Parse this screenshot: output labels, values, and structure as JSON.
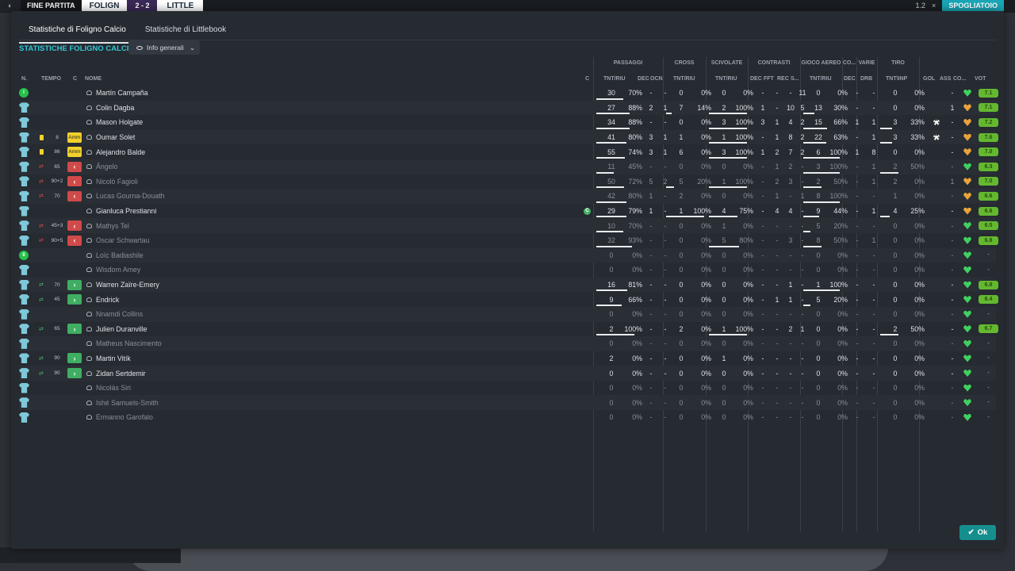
{
  "topbar": {
    "label": "FINE PARTITA",
    "home": "FOLIGN",
    "score": "2 - 2",
    "away": "LITTLE",
    "zoom": "1.2",
    "close": "×",
    "cta": "SPOGLIATOIO"
  },
  "tabs": [
    {
      "label": "Statistiche di Foligno Calcio"
    },
    {
      "label": "Statistiche di Littlebook"
    }
  ],
  "section_title": "STATISTICHE FOLIGNO CALCIO",
  "dropdown_label": "Info generali",
  "groups": {
    "passaggi": "PASSAGGI",
    "cross": "CROSS",
    "scivolate": "SCIVOLATE",
    "contrasti": "CONTRASTI",
    "gioco_aereo": "GIOCO AEREO",
    "co": "CO...",
    "varie": "VARIE",
    "tiro": "TIRO"
  },
  "columns": {
    "n": "N.",
    "tempo": "TEMPO",
    "c": "C",
    "nome": "NOME",
    "cap": "C",
    "pass_tnt": "TNT/RIU",
    "dec": "DEC",
    "ocn": "OCN",
    "cross_tnt": "TNT/RIU",
    "sciv_tnt": "TNT/RIU",
    "c_dec": "DEC",
    "fft": "FFT",
    "rec": "REC",
    "s": "S...",
    "aer_tnt": "TNT/RIU",
    "co_dec": "DEC",
    "drb": "DRB",
    "tiro_tnt": "TNT\\INP",
    "gol": "GOL",
    "ass": "ASS",
    "co": "CO...",
    "vot": "VOT"
  },
  "players": [
    {
      "pos": "I",
      "min": "",
      "card": "",
      "name": "Martín Campaña",
      "cap": "",
      "p": "30",
      "pp": "70%",
      "dec": "-",
      "ocn": "-",
      "cr": "0",
      "crp": "0%",
      "sc": "0",
      "scp": "0%",
      "cdec": "-",
      "fft": "-",
      "rec": "-",
      "s": "11",
      "ae": "0",
      "aep": "0%",
      "codec": "-",
      "drb": "-",
      "t": "0",
      "tp": "0%",
      "gol": "",
      "ass": "-",
      "heart": "g",
      "vote": "7.1",
      "dim": false
    },
    {
      "pos": "",
      "min": "",
      "card": "",
      "name": "Colin Dagba",
      "cap": "",
      "p": "27",
      "pp": "88%",
      "dec": "2",
      "ocn": "1",
      "cr": "7",
      "crp": "14%",
      "sc": "2",
      "scp": "100%",
      "cdec": "1",
      "fft": "-",
      "rec": "10",
      "s": "5",
      "ae": "13",
      "aep": "30%",
      "codec": "-",
      "drb": "-",
      "t": "0",
      "tp": "0%",
      "gol": "",
      "ass": "1",
      "heart": "o",
      "vote": "7.1",
      "dim": false
    },
    {
      "pos": "",
      "min": "",
      "card": "",
      "name": "Mason Holgate",
      "cap": "",
      "p": "34",
      "pp": "88%",
      "dec": "-",
      "ocn": "-",
      "cr": "0",
      "crp": "0%",
      "sc": "3",
      "scp": "100%",
      "cdec": "3",
      "fft": "1",
      "rec": "4",
      "s": "2",
      "ae": "15",
      "aep": "66%",
      "codec": "1",
      "drb": "1",
      "t": "3",
      "tp": "33%",
      "gol": "ball",
      "ass": "-",
      "heart": "o",
      "vote": "7.2",
      "dim": false
    },
    {
      "pos": "",
      "min": "8",
      "card": "Amm",
      "name": "Oumar Solet",
      "cap": "",
      "p": "41",
      "pp": "80%",
      "dec": "3",
      "ocn": "1",
      "cr": "1",
      "crp": "0%",
      "sc": "1",
      "scp": "100%",
      "cdec": "-",
      "fft": "1",
      "rec": "8",
      "s": "2",
      "ae": "22",
      "aep": "63%",
      "codec": "-",
      "drb": "1",
      "t": "3",
      "tp": "33%",
      "gol": "ball",
      "ass": "-",
      "heart": "o",
      "vote": "7.6",
      "dim": false
    },
    {
      "pos": "",
      "min": "86",
      "card": "Amm",
      "name": "Alejandro Balde",
      "cap": "",
      "p": "55",
      "pp": "74%",
      "dec": "3",
      "ocn": "1",
      "cr": "6",
      "crp": "0%",
      "sc": "3",
      "scp": "100%",
      "cdec": "1",
      "fft": "2",
      "rec": "7",
      "s": "2",
      "ae": "6",
      "aep": "100%",
      "codec": "1",
      "drb": "8",
      "t": "0",
      "tp": "0%",
      "gol": "",
      "ass": "-",
      "heart": "o",
      "vote": "7.0",
      "dim": false
    },
    {
      "pos": "",
      "min": "65",
      "card": "out",
      "name": "Ângelo",
      "cap": "",
      "p": "11",
      "pp": "45%",
      "dec": "-",
      "ocn": "-",
      "cr": "0",
      "crp": "0%",
      "sc": "0",
      "scp": "0%",
      "cdec": "-",
      "fft": "1",
      "rec": "2",
      "s": "-",
      "ae": "3",
      "aep": "100%",
      "codec": "-",
      "drb": "1",
      "t": "2",
      "tp": "50%",
      "gol": "",
      "ass": "-",
      "heart": "g",
      "vote": "6.3",
      "dim": true
    },
    {
      "pos": "",
      "min": "90+2",
      "card": "out",
      "name": "Nicolò Fagioli",
      "cap": "",
      "p": "50",
      "pp": "72%",
      "dec": "5",
      "ocn": "2",
      "cr": "5",
      "crp": "20%",
      "sc": "1",
      "scp": "100%",
      "cdec": "-",
      "fft": "2",
      "rec": "3",
      "s": "-",
      "ae": "2",
      "aep": "50%",
      "codec": "-",
      "drb": "1",
      "t": "2",
      "tp": "0%",
      "gol": "",
      "ass": "1",
      "heart": "o",
      "vote": "7.0",
      "dim": true
    },
    {
      "pos": "",
      "min": "70",
      "card": "out",
      "name": "Lucas Gourna-Douath",
      "cap": "",
      "p": "42",
      "pp": "80%",
      "dec": "1",
      "ocn": "-",
      "cr": "2",
      "crp": "0%",
      "sc": "0",
      "scp": "0%",
      "cdec": "-",
      "fft": "1",
      "rec": "-",
      "s": "1",
      "ae": "8",
      "aep": "100%",
      "codec": "-",
      "drb": "-",
      "t": "1",
      "tp": "0%",
      "gol": "",
      "ass": "-",
      "heart": "o",
      "vote": "6.6",
      "dim": true
    },
    {
      "pos": "",
      "min": "",
      "card": "",
      "name": "Gianluca Prestianni",
      "cap": "C",
      "p": "29",
      "pp": "79%",
      "dec": "1",
      "ocn": "-",
      "cr": "1",
      "crp": "100%",
      "sc": "4",
      "scp": "75%",
      "cdec": "-",
      "fft": "4",
      "rec": "4",
      "s": "-",
      "ae": "9",
      "aep": "44%",
      "codec": "-",
      "drb": "1",
      "t": "4",
      "tp": "25%",
      "gol": "",
      "ass": "-",
      "heart": "o",
      "vote": "6.6",
      "dim": false
    },
    {
      "pos": "",
      "min": "45+3",
      "card": "out",
      "name": "Mathys Tel",
      "cap": "",
      "p": "10",
      "pp": "70%",
      "dec": "-",
      "ocn": "-",
      "cr": "0",
      "crp": "0%",
      "sc": "1",
      "scp": "0%",
      "cdec": "-",
      "fft": "-",
      "rec": "-",
      "s": "-",
      "ae": "5",
      "aep": "20%",
      "codec": "-",
      "drb": "-",
      "t": "0",
      "tp": "0%",
      "gol": "",
      "ass": "-",
      "heart": "g",
      "vote": "6.5",
      "dim": true
    },
    {
      "pos": "",
      "min": "90+5",
      "card": "out",
      "name": "Oscar Schwartau",
      "cap": "",
      "p": "32",
      "pp": "93%",
      "dec": "-",
      "ocn": "-",
      "cr": "0",
      "crp": "0%",
      "sc": "5",
      "scp": "80%",
      "cdec": "-",
      "fft": "-",
      "rec": "3",
      "s": "-",
      "ae": "8",
      "aep": "50%",
      "codec": "-",
      "drb": "1",
      "t": "0",
      "tp": "0%",
      "gol": "",
      "ass": "-",
      "heart": "g",
      "vote": "6.8",
      "dim": true
    },
    {
      "pos": "II",
      "min": "",
      "card": "",
      "name": "Loïc Badiashile",
      "cap": "",
      "p": "0",
      "pp": "0%",
      "dec": "-",
      "ocn": "-",
      "cr": "0",
      "crp": "0%",
      "sc": "0",
      "scp": "0%",
      "cdec": "-",
      "fft": "-",
      "rec": "-",
      "s": "-",
      "ae": "0",
      "aep": "0%",
      "codec": "-",
      "drb": "-",
      "t": "0",
      "tp": "0%",
      "gol": "",
      "ass": "-",
      "heart": "g",
      "vote": "-",
      "dim": true
    },
    {
      "pos": "",
      "min": "",
      "card": "",
      "name": "Wisdom Amey",
      "cap": "",
      "p": "0",
      "pp": "0%",
      "dec": "-",
      "ocn": "-",
      "cr": "0",
      "crp": "0%",
      "sc": "0",
      "scp": "0%",
      "cdec": "-",
      "fft": "-",
      "rec": "-",
      "s": "-",
      "ae": "0",
      "aep": "0%",
      "codec": "-",
      "drb": "-",
      "t": "0",
      "tp": "0%",
      "gol": "",
      "ass": "-",
      "heart": "g",
      "vote": "-",
      "dim": true
    },
    {
      "pos": "",
      "min": "70",
      "card": "in",
      "name": "Warren Zaïre-Emery",
      "cap": "",
      "p": "16",
      "pp": "81%",
      "dec": "-",
      "ocn": "-",
      "cr": "0",
      "crp": "0%",
      "sc": "0",
      "scp": "0%",
      "cdec": "-",
      "fft": "-",
      "rec": "1",
      "s": "-",
      "ae": "1",
      "aep": "100%",
      "codec": "-",
      "drb": "-",
      "t": "0",
      "tp": "0%",
      "gol": "",
      "ass": "-",
      "heart": "g",
      "vote": "6.8",
      "dim": false
    },
    {
      "pos": "",
      "min": "45",
      "card": "in",
      "name": "Endrick",
      "cap": "",
      "p": "9",
      "pp": "66%",
      "dec": "-",
      "ocn": "-",
      "cr": "0",
      "crp": "0%",
      "sc": "0",
      "scp": "0%",
      "cdec": "-",
      "fft": "1",
      "rec": "1",
      "s": "-",
      "ae": "5",
      "aep": "20%",
      "codec": "-",
      "drb": "-",
      "t": "0",
      "tp": "0%",
      "gol": "",
      "ass": "-",
      "heart": "g",
      "vote": "6.4",
      "dim": false
    },
    {
      "pos": "",
      "min": "",
      "card": "",
      "name": "Nnamdi Collins",
      "cap": "",
      "p": "0",
      "pp": "0%",
      "dec": "-",
      "ocn": "-",
      "cr": "0",
      "crp": "0%",
      "sc": "0",
      "scp": "0%",
      "cdec": "-",
      "fft": "-",
      "rec": "-",
      "s": "-",
      "ae": "0",
      "aep": "0%",
      "codec": "-",
      "drb": "-",
      "t": "0",
      "tp": "0%",
      "gol": "",
      "ass": "-",
      "heart": "g",
      "vote": "-",
      "dim": true
    },
    {
      "pos": "",
      "min": "65",
      "card": "in",
      "name": "Julien Duranville",
      "cap": "",
      "p": "2",
      "pp": "100%",
      "dec": "-",
      "ocn": "-",
      "cr": "2",
      "crp": "0%",
      "sc": "1",
      "scp": "100%",
      "cdec": "-",
      "fft": "-",
      "rec": "2",
      "s": "1",
      "ae": "0",
      "aep": "0%",
      "codec": "-",
      "drb": "-",
      "t": "2",
      "tp": "50%",
      "gol": "",
      "ass": "-",
      "heart": "g",
      "vote": "6.7",
      "dim": false
    },
    {
      "pos": "",
      "min": "",
      "card": "",
      "name": "Matheus Nascimento",
      "cap": "",
      "p": "0",
      "pp": "0%",
      "dec": "-",
      "ocn": "-",
      "cr": "0",
      "crp": "0%",
      "sc": "0",
      "scp": "0%",
      "cdec": "-",
      "fft": "-",
      "rec": "-",
      "s": "-",
      "ae": "0",
      "aep": "0%",
      "codec": "-",
      "drb": "-",
      "t": "0",
      "tp": "0%",
      "gol": "",
      "ass": "-",
      "heart": "g",
      "vote": "-",
      "dim": true
    },
    {
      "pos": "",
      "min": "90",
      "card": "in",
      "name": "Martin Vitík",
      "cap": "",
      "p": "2",
      "pp": "0%",
      "dec": "-",
      "ocn": "-",
      "cr": "0",
      "crp": "0%",
      "sc": "1",
      "scp": "0%",
      "cdec": "-",
      "fft": "-",
      "rec": "-",
      "s": "-",
      "ae": "0",
      "aep": "0%",
      "codec": "-",
      "drb": "-",
      "t": "0",
      "tp": "0%",
      "gol": "",
      "ass": "-",
      "heart": "g",
      "vote": "-",
      "dim": false
    },
    {
      "pos": "",
      "min": "90",
      "card": "in",
      "name": "Zidan Sertdemir",
      "cap": "",
      "p": "0",
      "pp": "0%",
      "dec": "-",
      "ocn": "-",
      "cr": "0",
      "crp": "0%",
      "sc": "0",
      "scp": "0%",
      "cdec": "-",
      "fft": "-",
      "rec": "-",
      "s": "-",
      "ae": "0",
      "aep": "0%",
      "codec": "-",
      "drb": "-",
      "t": "0",
      "tp": "0%",
      "gol": "",
      "ass": "-",
      "heart": "g",
      "vote": "-",
      "dim": false
    },
    {
      "pos": "",
      "min": "",
      "card": "",
      "name": "Nicolás Siri",
      "cap": "",
      "p": "0",
      "pp": "0%",
      "dec": "-",
      "ocn": "-",
      "cr": "0",
      "crp": "0%",
      "sc": "0",
      "scp": "0%",
      "cdec": "-",
      "fft": "-",
      "rec": "-",
      "s": "-",
      "ae": "0",
      "aep": "0%",
      "codec": "-",
      "drb": "-",
      "t": "0",
      "tp": "0%",
      "gol": "",
      "ass": "-",
      "heart": "g",
      "vote": "-",
      "dim": true
    },
    {
      "pos": "",
      "min": "",
      "card": "",
      "name": "Ishé Samuels-Smith",
      "cap": "",
      "p": "0",
      "pp": "0%",
      "dec": "-",
      "ocn": "-",
      "cr": "0",
      "crp": "0%",
      "sc": "0",
      "scp": "0%",
      "cdec": "-",
      "fft": "-",
      "rec": "-",
      "s": "-",
      "ae": "0",
      "aep": "0%",
      "codec": "-",
      "drb": "-",
      "t": "0",
      "tp": "0%",
      "gol": "",
      "ass": "-",
      "heart": "g",
      "vote": "-",
      "dim": true
    },
    {
      "pos": "",
      "min": "",
      "card": "",
      "name": "Ermanno Garofalo",
      "cap": "",
      "p": "0",
      "pp": "0%",
      "dec": "-",
      "ocn": "-",
      "cr": "0",
      "crp": "0%",
      "sc": "0",
      "scp": "0%",
      "cdec": "-",
      "fft": "-",
      "rec": "-",
      "s": "-",
      "ae": "0",
      "aep": "0%",
      "codec": "-",
      "drb": "-",
      "t": "0",
      "tp": "0%",
      "gol": "",
      "ass": "-",
      "heart": "g",
      "vote": "-",
      "dim": true
    }
  ],
  "ok_label": "Ok",
  "icons": {
    "shirt": "shirt-icon",
    "yellow_card": "yellow-card-icon",
    "sub_out": "substitution-out-icon",
    "sub_in": "substitution-in-icon",
    "person": "person-icon",
    "goal": "ball-icon",
    "condition": "heart-icon",
    "check": "check-icon"
  },
  "colors": {
    "accent": "#31c7d6",
    "ok_button": "#158e8e",
    "yellow_card": "#f2d02c",
    "sub_out": "#d04a4a",
    "sub_in": "#3fae62",
    "vote_high": "#63b82f"
  }
}
